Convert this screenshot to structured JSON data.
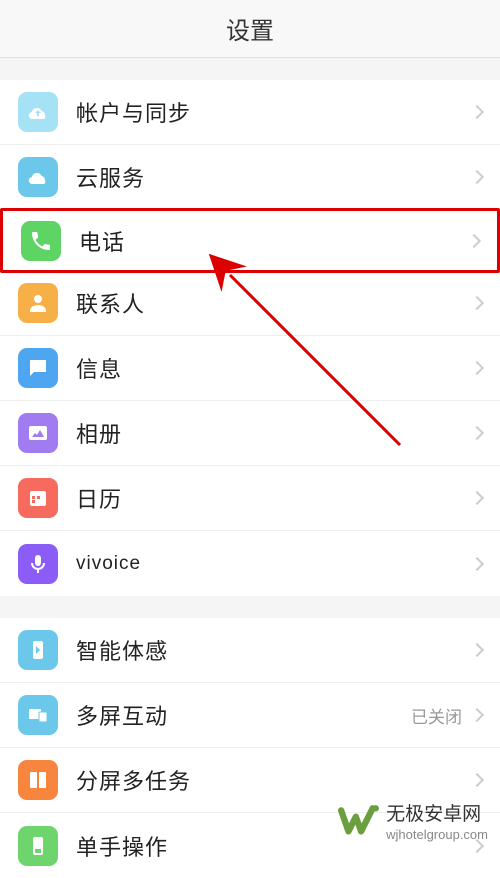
{
  "header": {
    "title": "设置"
  },
  "sections": [
    {
      "items": [
        {
          "id": "account-sync",
          "label": "帐户与同步",
          "icon": "cloud-sync-icon",
          "color": "#5ec9ea"
        },
        {
          "id": "cloud-service",
          "label": "云服务",
          "icon": "cloud-icon",
          "color": "#5ec9ea"
        },
        {
          "id": "phone",
          "label": "电话",
          "icon": "phone-icon",
          "color": "#5dd464",
          "highlighted": true
        },
        {
          "id": "contacts",
          "label": "联系人",
          "icon": "contact-icon",
          "color": "#f7b047"
        },
        {
          "id": "messages",
          "label": "信息",
          "icon": "message-icon",
          "color": "#4ea6f0"
        },
        {
          "id": "gallery",
          "label": "相册",
          "icon": "gallery-icon",
          "color": "#8b5cf6"
        },
        {
          "id": "calendar",
          "label": "日历",
          "icon": "calendar-icon",
          "color": "#f66b5e"
        },
        {
          "id": "vivoice",
          "label": "vivoice",
          "icon": "mic-icon",
          "color": "#8b5cf6"
        }
      ]
    },
    {
      "items": [
        {
          "id": "smart-motion",
          "label": "智能体感",
          "icon": "smart-icon",
          "color": "#47c0f0"
        },
        {
          "id": "multi-screen",
          "label": "多屏互动",
          "icon": "multiscreen-icon",
          "color": "#47c0f0",
          "status": "已关闭"
        },
        {
          "id": "split-screen",
          "label": "分屏多任务",
          "icon": "split-icon",
          "color": "#f7853e"
        },
        {
          "id": "one-hand",
          "label": "单手操作",
          "icon": "onehand-icon",
          "color": "#5dd464"
        }
      ]
    }
  ],
  "watermark": {
    "title": "无极安卓网",
    "url": "wjhotelgroup.com"
  }
}
